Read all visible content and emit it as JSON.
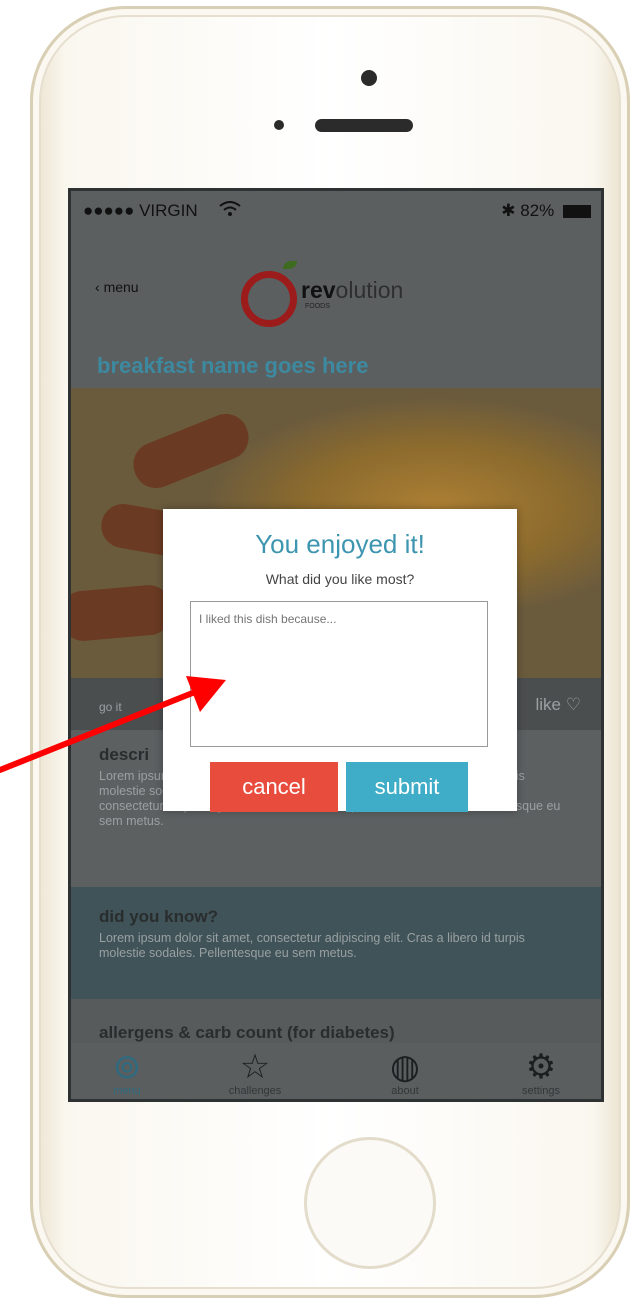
{
  "status_bar": {
    "carrier": "●●●●● VIRGIN",
    "battery": "82%"
  },
  "nav": {
    "back_label": "menu",
    "logo_text_bold": "rev",
    "logo_text_rest": "olution",
    "logo_sub": "FOODS"
  },
  "page": {
    "title": "breakfast name goes here"
  },
  "like_bar": {
    "left_label": "go it",
    "right_label": "like"
  },
  "description": {
    "title": "descri",
    "body": "Lorem ipsum dolor sit amet, consectetur adipiscing elit. Cras a libero id turpis molestie sodales. Pellentesque eu sem metus. Lorem ipsum dolor sit amet, consectetur adipiscing elit. Cras a libero id turpis molestie sodales. Pellentesque eu sem metus."
  },
  "did_you_know": {
    "title": "did you know?",
    "body": "Lorem ipsum dolor sit amet, consectetur adipiscing elit. Cras a libero id turpis molestie sodales. Pellentesque eu sem metus."
  },
  "allergens": {
    "title": "allergens & carb count (for diabetes)"
  },
  "tabs": [
    {
      "label": "menu",
      "icon": "utensils-icon"
    },
    {
      "label": "challenges",
      "icon": "star-icon"
    },
    {
      "label": "about",
      "icon": "globe-icon"
    },
    {
      "label": "settings",
      "icon": "gear-icon"
    }
  ],
  "dialog": {
    "title": "You enjoyed it!",
    "subtitle": "What did you like most?",
    "placeholder": "I liked this dish because...",
    "cancel_label": "cancel",
    "submit_label": "submit"
  },
  "colors": {
    "accent": "#3d95b0",
    "cancel": "#e84c3d",
    "submit": "#3fadc7",
    "arrow": "#ff0000"
  }
}
